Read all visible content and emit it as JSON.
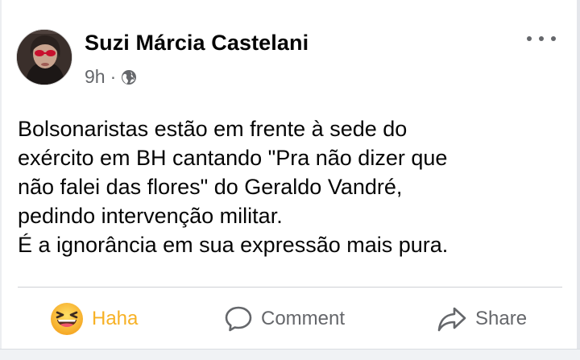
{
  "post": {
    "author": "Suzi Márcia Castelani",
    "time": "9h",
    "separator": "·",
    "privacy_icon": "globe-icon",
    "more_icon": "more-options-icon",
    "body_lines": [
      "Bolsonaristas estão em frente à sede do",
      "exército em BH cantando \"Pra não dizer que",
      "não falei das flores\" do Geraldo Vandré,",
      "pedindo intervenção militar.",
      "É a ignorância em sua expressão mais pura."
    ]
  },
  "actions": {
    "reaction_label": "Haha",
    "reaction_icon": "haha-emoji-icon",
    "comment_label": "Comment",
    "comment_icon": "comment-icon",
    "share_label": "Share",
    "share_icon": "share-icon"
  },
  "colors": {
    "haha": "#f7b125",
    "secondary_text": "#65676b",
    "primary_text": "#050505"
  }
}
